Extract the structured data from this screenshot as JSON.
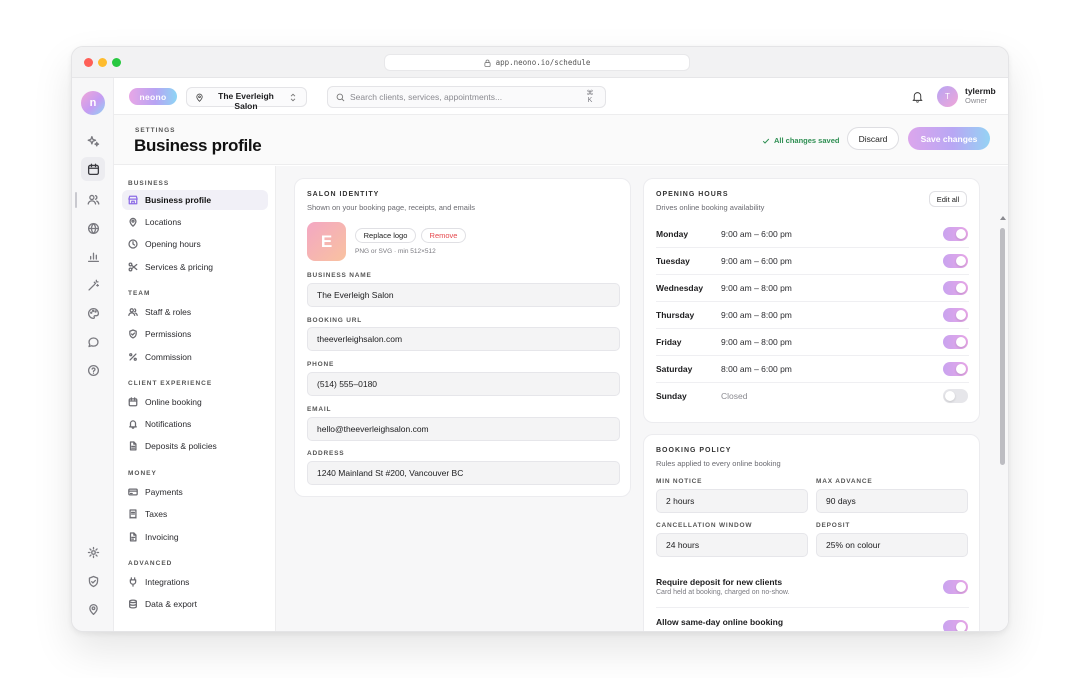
{
  "browser": {
    "url": "app.neono.io/schedule"
  },
  "rail": {
    "logo_letter": "n"
  },
  "topbar": {
    "brand": "neono",
    "location": "The Everleigh Salon",
    "search_placeholder": "Search clients, services, appointments...",
    "shortcut": "⌘ K",
    "user_initial": "T",
    "user_name": "tylermb",
    "user_role": "Owner"
  },
  "header": {
    "crumb": "SETTINGS",
    "title": "Business profile",
    "saved_status": "All changes saved",
    "discard_label": "Discard",
    "save_label": "Save changes"
  },
  "nav": {
    "sections": [
      {
        "title": "BUSINESS",
        "items": [
          "Business profile",
          "Locations",
          "Opening hours",
          "Services & pricing"
        ]
      },
      {
        "title": "TEAM",
        "items": [
          "Staff & roles",
          "Permissions",
          "Commission"
        ]
      },
      {
        "title": "CLIENT EXPERIENCE",
        "items": [
          "Online booking",
          "Notifications",
          "Deposits & policies"
        ]
      },
      {
        "title": "MONEY",
        "items": [
          "Payments",
          "Taxes",
          "Invoicing"
        ]
      },
      {
        "title": "ADVANCED",
        "items": [
          "Integrations",
          "Data & export"
        ]
      }
    ]
  },
  "identity": {
    "title": "SALON IDENTITY",
    "subtitle": "Shown on your booking page, receipts, and emails",
    "logo_letter": "E",
    "replace_label": "Replace logo",
    "remove_label": "Remove",
    "logo_hint": "PNG or SVG · min 512×512",
    "fields": [
      {
        "label": "BUSINESS NAME",
        "value": "The Everleigh Salon"
      },
      {
        "label": "BOOKING URL",
        "value": "theeverleighsalon.com"
      },
      {
        "label": "PHONE",
        "value": "(514) 555–0180"
      },
      {
        "label": "EMAIL",
        "value": "hello@theeverleighsalon.com"
      },
      {
        "label": "ADDRESS",
        "value": "1240 Mainland St #200, Vancouver BC"
      }
    ]
  },
  "hours": {
    "title": "OPENING HOURS",
    "subtitle": "Drives online booking availability",
    "edit_label": "Edit all",
    "days": [
      {
        "day": "Monday",
        "hours": "9:00 am – 6:00 pm",
        "open": true
      },
      {
        "day": "Tuesday",
        "hours": "9:00 am – 6:00 pm",
        "open": true
      },
      {
        "day": "Wednesday",
        "hours": "9:00 am – 8:00 pm",
        "open": true
      },
      {
        "day": "Thursday",
        "hours": "9:00 am – 8:00 pm",
        "open": true
      },
      {
        "day": "Friday",
        "hours": "9:00 am – 8:00 pm",
        "open": true
      },
      {
        "day": "Saturday",
        "hours": "8:00 am – 6:00 pm",
        "open": true
      },
      {
        "day": "Sunday",
        "hours": "Closed",
        "open": false
      }
    ]
  },
  "policy": {
    "title": "BOOKING POLICY",
    "subtitle": "Rules applied to every online booking",
    "fields": [
      {
        "label": "MIN NOTICE",
        "value": "2 hours"
      },
      {
        "label": "MAX ADVANCE",
        "value": "90 days"
      },
      {
        "label": "CANCELLATION WINDOW",
        "value": "24 hours"
      },
      {
        "label": "DEPOSIT",
        "value": "25% on colour"
      }
    ],
    "toggles": [
      {
        "title": "Require deposit for new clients",
        "sub": "Card held at booking, charged on no-show.",
        "on": true
      },
      {
        "title": "Allow same-day online booking",
        "sub": "",
        "on": true
      }
    ]
  },
  "colors": {
    "accent": "#b8a7f4",
    "saved": "#2f8f53",
    "danger": "#e5484d"
  }
}
